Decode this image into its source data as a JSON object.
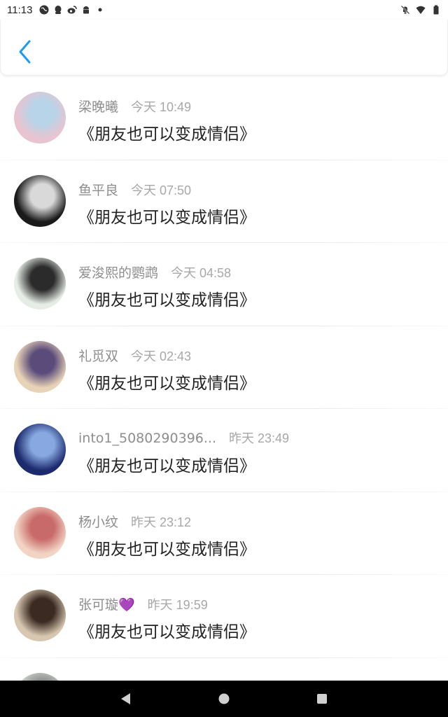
{
  "status_bar": {
    "time": "11:13",
    "left_icons": [
      "globe-icon",
      "qq-icon",
      "weibo-icon",
      "android-icon",
      "dot-icon"
    ],
    "right_icons": [
      "mute-icon",
      "wifi-icon",
      "battery-icon"
    ]
  },
  "header": {
    "back_icon": "chevron-left-icon",
    "accent_color": "#1e9bf0"
  },
  "comments": [
    {
      "name": "梁晚曦",
      "time": "今天 10:49",
      "text": "《朋友也可以变成情侣》",
      "avatar_colors": [
        "#e8c4d0",
        "#b7d4e8"
      ]
    },
    {
      "name": "鱼平良",
      "time": "今天 07:50",
      "text": "《朋友也可以变成情侣》",
      "avatar_colors": [
        "#1a1a1a",
        "#d9d9d9"
      ]
    },
    {
      "name": "爱浚熙的鹦鹉",
      "time": "今天 04:58",
      "text": "《朋友也可以变成情侣》",
      "avatar_colors": [
        "#e6ece6",
        "#2b2b2b"
      ]
    },
    {
      "name": "礼觅双",
      "time": "今天 02:43",
      "text": "《朋友也可以变成情侣》",
      "avatar_colors": [
        "#e9d3b8",
        "#5a4b7a"
      ]
    },
    {
      "name": "into1_5080290396...",
      "time": "昨天 23:49",
      "text": "《朋友也可以变成情侣》",
      "avatar_colors": [
        "#1c2a6e",
        "#87a8e0"
      ]
    },
    {
      "name": "杨小纹",
      "time": "昨天 23:12",
      "text": "《朋友也可以变成情侣》",
      "avatar_colors": [
        "#f2d4c4",
        "#c96a6a"
      ]
    },
    {
      "name": "张可璇💜",
      "time": "昨天 19:59",
      "text": "《朋友也可以变成情侣》",
      "avatar_colors": [
        "#d8c7b0",
        "#3a2a22"
      ]
    },
    {
      "name": "",
      "time": "",
      "text": "",
      "avatar_colors": [
        "#cfd6cf",
        "#888888"
      ]
    }
  ],
  "nav_bar": {
    "buttons": [
      "back-triangle-icon",
      "home-circle-icon",
      "recents-square-icon"
    ]
  }
}
